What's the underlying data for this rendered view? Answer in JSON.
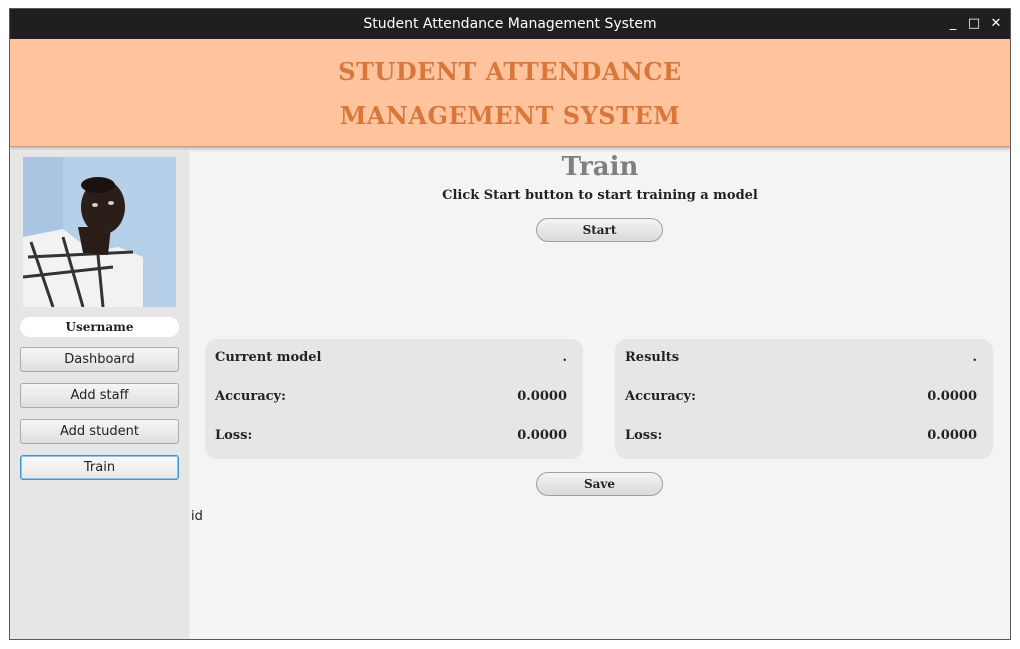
{
  "window": {
    "title": "Student Attendance Management System",
    "controls": {
      "minimize": "_",
      "maximize": "□",
      "close": "✕"
    }
  },
  "banner": {
    "line1": "STUDENT ATTENDANCE",
    "line2": "MANAGEMENT SYSTEM",
    "color": "#d9773a",
    "background": "#ffc49e"
  },
  "sidebar": {
    "username": "Username",
    "items": [
      {
        "label": "Dashboard",
        "active": false
      },
      {
        "label": "Add staff",
        "active": false
      },
      {
        "label": "Add student",
        "active": false
      },
      {
        "label": "Train",
        "active": true
      }
    ],
    "stray_label": "id"
  },
  "main": {
    "title": "Train",
    "subtitle": "Click Start button to start training a model",
    "start_label": "Start",
    "save_label": "Save",
    "current_model": {
      "heading": "Current model",
      "status": ".",
      "accuracy_label": "Accuracy:",
      "accuracy": "0.0000",
      "loss_label": "Loss:",
      "loss": "0.0000"
    },
    "results": {
      "heading": "Results",
      "status": ".",
      "accuracy_label": "Accuracy:",
      "accuracy": "0.0000",
      "loss_label": "Loss:",
      "loss": "0.0000"
    }
  },
  "icons": {
    "minimize": "minimize-icon",
    "maximize": "maximize-icon",
    "close": "close-icon",
    "avatar": "user-photo"
  }
}
